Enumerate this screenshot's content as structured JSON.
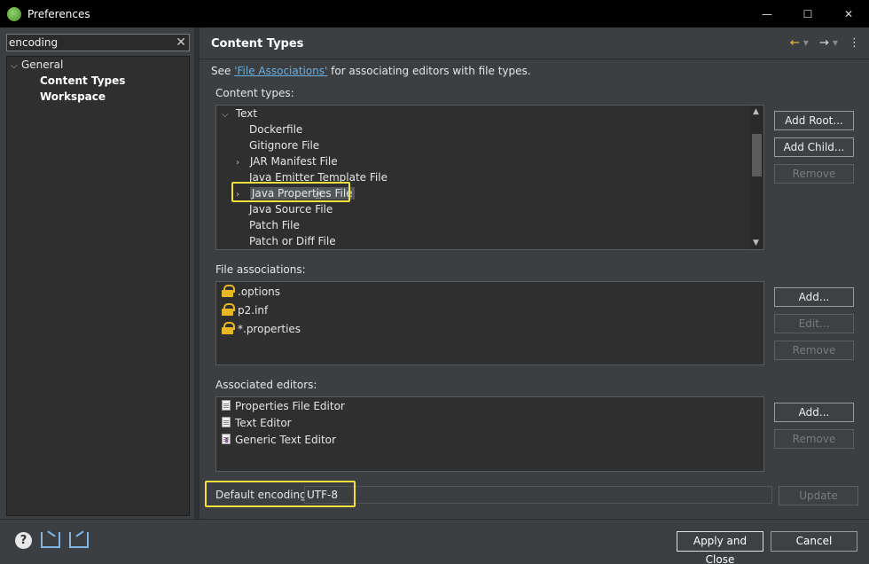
{
  "window": {
    "title": "Preferences",
    "minimize": "—",
    "maximize": "☐",
    "close": "✕"
  },
  "filter": {
    "value": "encoding",
    "clear": "✕"
  },
  "tree": {
    "items": [
      {
        "label": "General"
      },
      {
        "label": "Content Types"
      },
      {
        "label": "Workspace"
      }
    ]
  },
  "page": {
    "title": "Content Types",
    "see_prefix": "See ",
    "see_link": "'File Associations'",
    "see_suffix": " for associating editors with file types."
  },
  "content_types": {
    "label": "Content types:",
    "items": [
      {
        "label": "Text"
      },
      {
        "label": "Dockerfile"
      },
      {
        "label": "Gitignore File"
      },
      {
        "label": "JAR Manifest File"
      },
      {
        "label": "Java Emitter Template File"
      },
      {
        "label": "Java Properties File"
      },
      {
        "label": "Java Source File"
      },
      {
        "label": "Patch File"
      },
      {
        "label": "Patch or Diff File"
      }
    ],
    "buttons": {
      "add_root": "Add Root...",
      "add_child": "Add Child...",
      "remove": "Remove"
    }
  },
  "file_associations": {
    "label": "File associations:",
    "items": [
      {
        "label": ".options"
      },
      {
        "label": "p2.inf"
      },
      {
        "label": "*.properties"
      }
    ],
    "buttons": {
      "add": "Add...",
      "edit": "Edit...",
      "remove": "Remove"
    }
  },
  "associated_editors": {
    "label": "Associated editors:",
    "items": [
      {
        "label": "Properties File Editor"
      },
      {
        "label": "Text Editor"
      },
      {
        "label": "Generic Text Editor"
      }
    ],
    "buttons": {
      "add": "Add...",
      "remove": "Remove"
    }
  },
  "encoding": {
    "label": "Default encoding:",
    "value": "UTF-8",
    "update": "Update"
  },
  "footer": {
    "apply_close": "Apply and Close",
    "cancel": "Cancel",
    "help": "?"
  },
  "colors": {
    "highlight": "#f1e13a",
    "link": "#6ab0e0",
    "lock": "#e8b820"
  }
}
